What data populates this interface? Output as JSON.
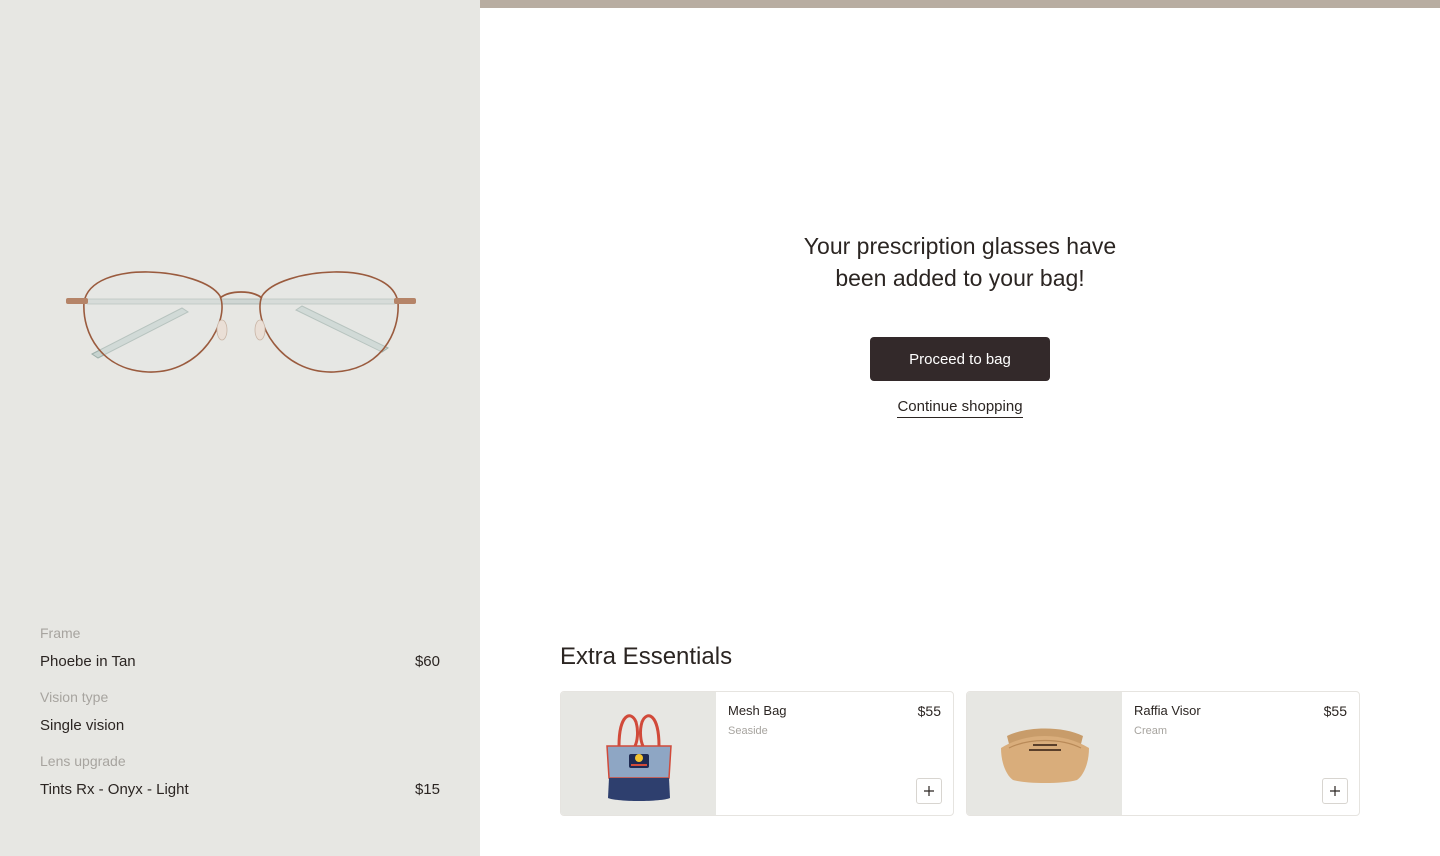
{
  "hero": {
    "title": "Your prescription glasses have been added to your bag!",
    "primary_button": "Proceed to bag",
    "secondary_link": "Continue shopping"
  },
  "summary": {
    "items": [
      {
        "label": "Frame",
        "value": "Phoebe in Tan",
        "price": "$60"
      },
      {
        "label": "Vision type",
        "value": "Single vision",
        "price": ""
      },
      {
        "label": "Lens upgrade",
        "value": "Tints Rx - Onyx - Light",
        "price": "$15"
      }
    ]
  },
  "extras": {
    "title": "Extra Essentials",
    "products": [
      {
        "name": "Mesh Bag",
        "variant": "Seaside",
        "price": "$55",
        "image_icon": "mesh-bag-image"
      },
      {
        "name": "Raffia Visor",
        "variant": "Cream",
        "price": "$55",
        "image_icon": "raffia-visor-image"
      }
    ]
  },
  "colors": {
    "left_panel_bg": "#e7e7e3",
    "top_bar": "#b8ada1",
    "primary_button_bg": "#33292a",
    "text": "#2b2522",
    "muted_text": "#a7a49f"
  }
}
